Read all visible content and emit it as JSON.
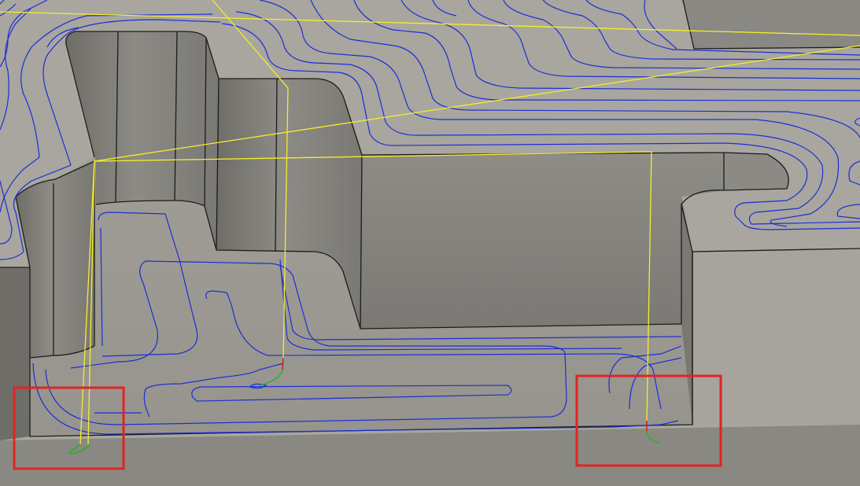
{
  "viewport": {
    "description_label": "",
    "colors": {
      "background": "#8c8a84",
      "top_surface": "#a6a49d",
      "pocket_floor": "#9c9a93",
      "wall_face": "#7f7d77",
      "wall_face_light": "#8f8d87",
      "edge": "#1c1c1a",
      "toolpath": "#1d2ed6",
      "rapid_move": "#f4ee2a",
      "lead_in": "#23b32c",
      "plunge": "#d81f1f",
      "highlight_box": "#e02424"
    }
  }
}
